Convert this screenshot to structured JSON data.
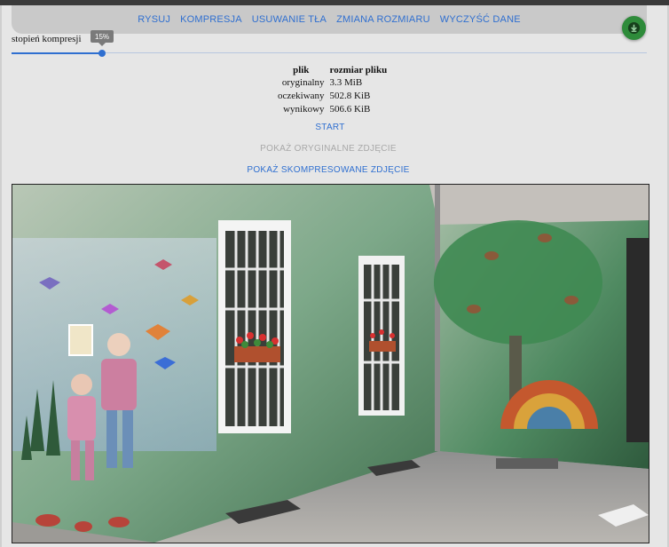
{
  "nav": {
    "items": [
      "RYSUJ",
      "KOMPRESJA",
      "USUWANIE TŁA",
      "ZMIANA ROZMIARU",
      "WYCZYŚĆ DANE"
    ]
  },
  "fab": {
    "icon": "download-icon",
    "color": "#2e8b3a"
  },
  "slider": {
    "label": "stopień kompresji",
    "value_label": "15%",
    "value": 0.15
  },
  "table": {
    "headers": [
      "plik",
      "rozmiar pliku"
    ],
    "rows": [
      [
        "oryginalny",
        "3.3 MiB"
      ],
      [
        "oczekiwany",
        "502.8 KiB"
      ],
      [
        "wynikowy",
        "506.6 KiB"
      ]
    ]
  },
  "actions": {
    "start": "START",
    "show_original": "POKAŻ ORYGINALNE ZDJĘCIE",
    "show_compressed": "POKAŻ SKOMPRESOWANE ZDJĘCIE"
  },
  "colors": {
    "accent": "#2f6fd0",
    "disabled": "#a8a8a8",
    "nav_bg": "#c9c9c9"
  }
}
